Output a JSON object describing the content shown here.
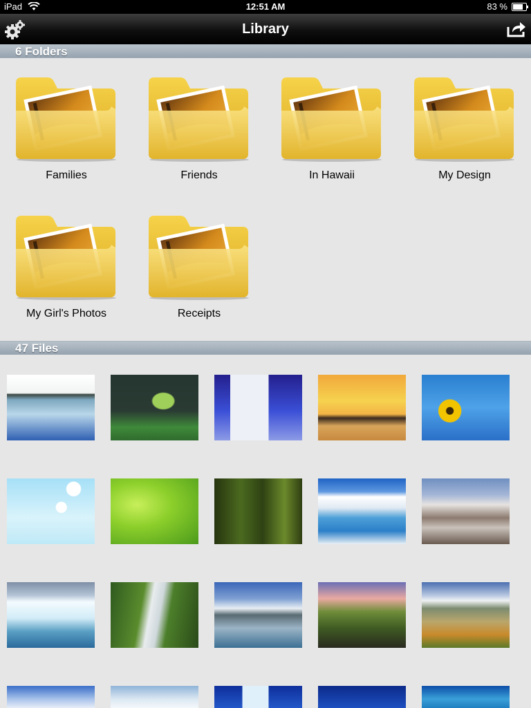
{
  "status_bar": {
    "device": "iPad",
    "time": "12:51 AM",
    "battery": "83 %",
    "battery_level": 0.83
  },
  "nav": {
    "title": "Library",
    "settings_icon": "gear-icon",
    "share_icon": "share-icon"
  },
  "folders_header": "6 Folders",
  "folders": [
    {
      "label": "Families"
    },
    {
      "label": "Friends"
    },
    {
      "label": "In Hawaii"
    },
    {
      "label": "My Design"
    },
    {
      "label": "My Girl's Photos"
    },
    {
      "label": "Receipts"
    }
  ],
  "files_header": "47 Files",
  "files": [
    {
      "name": "thumb-lake"
    },
    {
      "name": "thumb-green-hearts"
    },
    {
      "name": "thumb-church"
    },
    {
      "name": "thumb-sunset-beach"
    },
    {
      "name": "thumb-sunflower"
    },
    {
      "name": "thumb-dandelion"
    },
    {
      "name": "thumb-green-flower"
    },
    {
      "name": "thumb-forest-stream"
    },
    {
      "name": "thumb-glacier-lake"
    },
    {
      "name": "thumb-mountain-valley"
    },
    {
      "name": "thumb-iceberg"
    },
    {
      "name": "thumb-waterfall"
    },
    {
      "name": "thumb-snow-mountain"
    },
    {
      "name": "thumb-hills"
    },
    {
      "name": "thumb-river-delta"
    },
    {
      "name": "thumb-sky"
    },
    {
      "name": "thumb-snowfield"
    },
    {
      "name": "thumb-ice-blue"
    },
    {
      "name": "thumb-blue-sky"
    },
    {
      "name": "thumb-wave"
    }
  ]
}
